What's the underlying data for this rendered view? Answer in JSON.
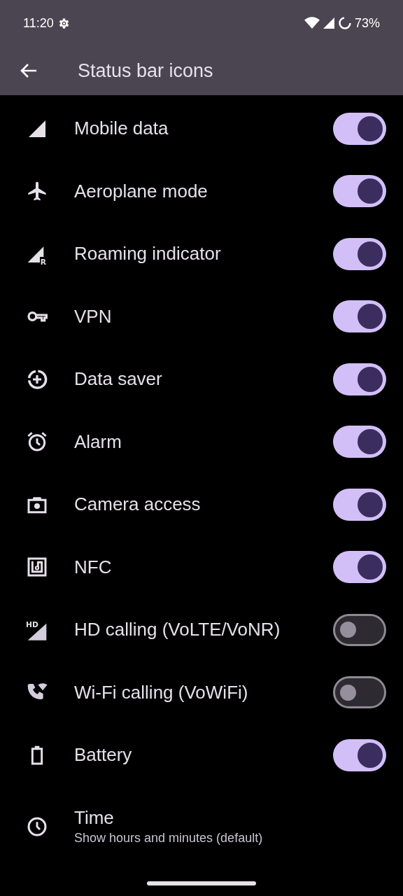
{
  "status_bar": {
    "time": "11:20",
    "battery": "73%"
  },
  "app_bar": {
    "title": "Status bar icons"
  },
  "items": [
    {
      "label": "Mobile data",
      "on": true
    },
    {
      "label": "Aeroplane mode",
      "on": true
    },
    {
      "icon_text": "R",
      "label": "Roaming indicator",
      "on": true
    },
    {
      "label": "VPN",
      "on": true
    },
    {
      "label": "Data saver",
      "on": true
    },
    {
      "label": "Alarm",
      "on": true
    },
    {
      "label": "Camera access",
      "on": true
    },
    {
      "label": "NFC",
      "on": true
    },
    {
      "icon_text": "HD",
      "label": "HD calling (VoLTE/VoNR)",
      "on": false
    },
    {
      "label": "Wi-Fi calling (VoWiFi)",
      "on": false
    },
    {
      "label": "Battery",
      "on": true
    }
  ],
  "time_item": {
    "title": "Time",
    "summary": "Show hours and minutes (default)"
  }
}
